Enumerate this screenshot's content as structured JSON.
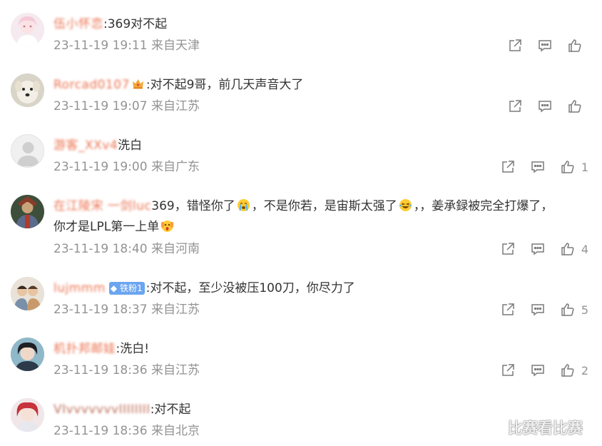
{
  "comments": [
    {
      "username": "伍小怀恋",
      "text": ":369对不起",
      "meta": "23-11-19 19:11 来自天津",
      "likes": "",
      "avatar": "pink-anime-girl"
    },
    {
      "username": "Rorcad0107",
      "text": ":对不起9哥，前几天声音大了",
      "meta": "23-11-19 19:07 来自江苏",
      "likes": "",
      "avatar": "white-dog"
    },
    {
      "username": "游客_XXv4",
      "text": "洗白",
      "meta": "23-11-19 19:00 来自广东",
      "likes": "1",
      "avatar": "default-user"
    },
    {
      "username": "在江陵宋 一剑luc",
      "text_line1a": "369，错怪你了",
      "text_line1b": "，不是你若，是宙斯太强了",
      "text_line1c": "，，姜承録被完全打爆了，",
      "text_line2": "你才是LPL第一上单",
      "meta": "23-11-19 18:40 来自河南",
      "likes": "4",
      "avatar": "game-character"
    },
    {
      "username": "lujmmm",
      "fan_badge": "铁粉1",
      "text": ":对不起，至少没被压100刀，你尽力了",
      "meta": "23-11-19 18:37 来自江苏",
      "likes": "5",
      "avatar": "couple-photo"
    },
    {
      "username": "机扑邦邮娃",
      "text": ":洗白!",
      "meta": "23-11-19 18:36 来自江苏",
      "likes": "2",
      "avatar": "dark-hair-person"
    },
    {
      "username": "VIvvvvvvvIIIIIIII",
      "text": ":对不起",
      "meta": "23-11-19 18:36 来自北京",
      "likes": "",
      "avatar": "red-hair-anime"
    }
  ],
  "watermark": "比赛看比赛",
  "colors": {
    "username": "#eb7350",
    "meta": "#939393",
    "text": "#333333",
    "badge_fan": "#6ba5f0"
  }
}
